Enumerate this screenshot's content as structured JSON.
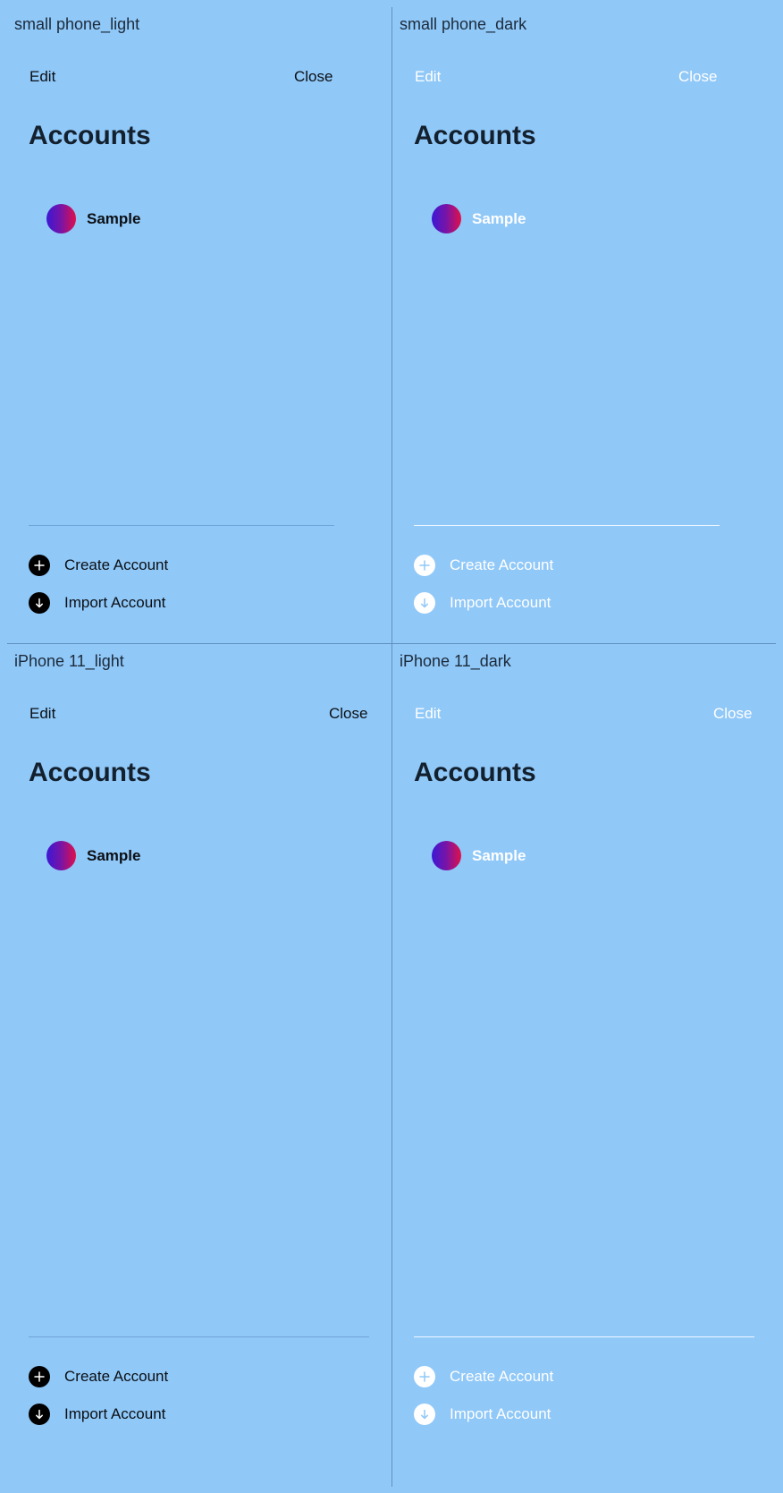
{
  "frames": [
    {
      "label": "small phone_light",
      "theme": "light"
    },
    {
      "label": "small phone_dark",
      "theme": "dark"
    },
    {
      "label": "iPhone 11_light",
      "theme": "light"
    },
    {
      "label": "iPhone 11_dark",
      "theme": "dark"
    }
  ],
  "nav": {
    "edit": "Edit",
    "close": "Close"
  },
  "title": "Accounts",
  "account": {
    "name": "Sample",
    "avatar_gradient": [
      "#3a18d4",
      "#e0104a"
    ]
  },
  "actions": {
    "create": {
      "label": "Create Account",
      "icon": "plus-icon"
    },
    "import": {
      "label": "Import Account",
      "icon": "arrow-down-icon"
    }
  },
  "colors": {
    "background": "#90c8f8",
    "title": "#13202e",
    "light_text": "#0b0f14",
    "dark_text": "#ffffff"
  }
}
